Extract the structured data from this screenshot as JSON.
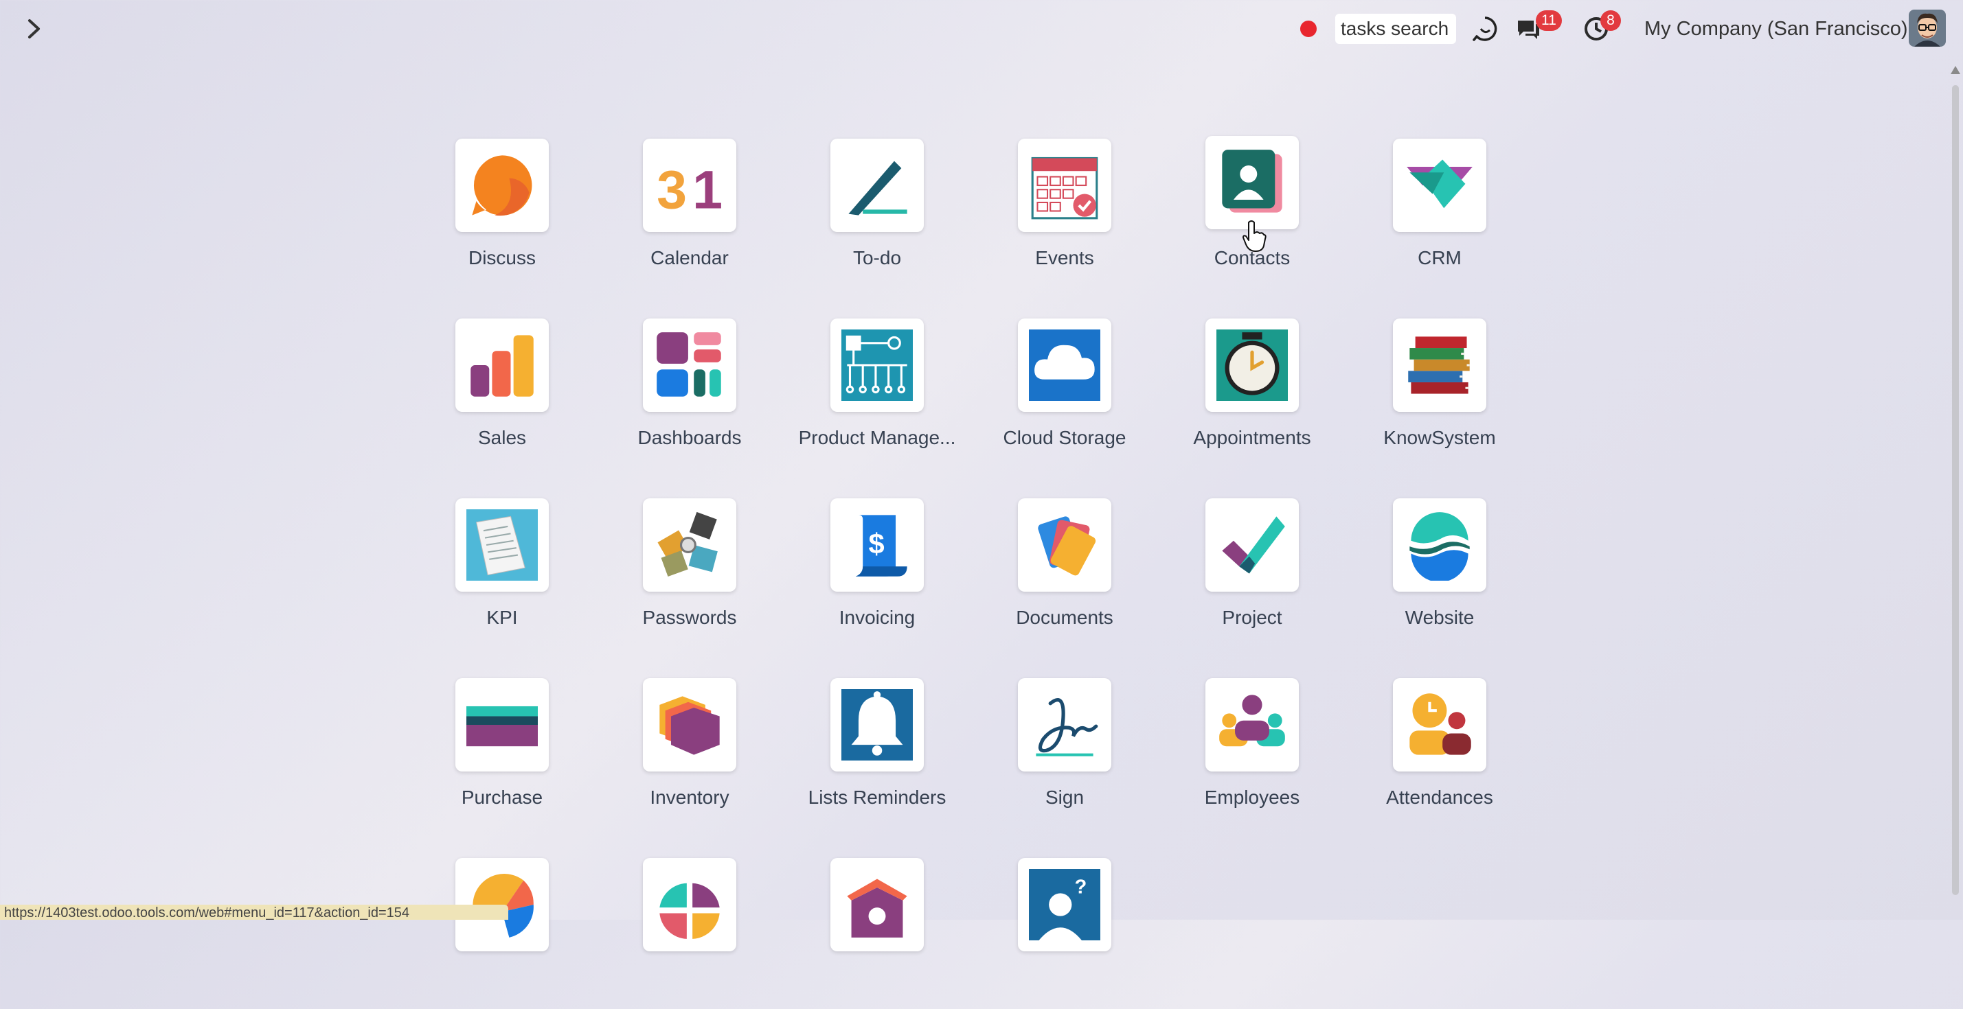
{
  "topbar": {
    "search_text": "tasks search",
    "messages_badge": "11",
    "activities_badge": "8",
    "company": "My Company (San Francisco)"
  },
  "apps": [
    {
      "label": "Discuss",
      "icon": "discuss-icon"
    },
    {
      "label": "Calendar",
      "icon": "calendar-icon"
    },
    {
      "label": "To-do",
      "icon": "todo-icon"
    },
    {
      "label": "Events",
      "icon": "events-icon"
    },
    {
      "label": "Contacts",
      "icon": "contacts-icon"
    },
    {
      "label": "CRM",
      "icon": "crm-icon"
    },
    {
      "label": "Sales",
      "icon": "sales-icon"
    },
    {
      "label": "Dashboards",
      "icon": "dashboards-icon"
    },
    {
      "label": "Product Manage...",
      "icon": "product-management-icon"
    },
    {
      "label": "Cloud Storage",
      "icon": "cloud-storage-icon"
    },
    {
      "label": "Appointments",
      "icon": "appointments-icon"
    },
    {
      "label": "KnowSystem",
      "icon": "knowsystem-icon"
    },
    {
      "label": "KPI",
      "icon": "kpi-icon"
    },
    {
      "label": "Passwords",
      "icon": "passwords-icon"
    },
    {
      "label": "Invoicing",
      "icon": "invoicing-icon"
    },
    {
      "label": "Documents",
      "icon": "documents-icon"
    },
    {
      "label": "Project",
      "icon": "project-icon"
    },
    {
      "label": "Website",
      "icon": "website-icon"
    },
    {
      "label": "Purchase",
      "icon": "purchase-icon"
    },
    {
      "label": "Inventory",
      "icon": "inventory-icon"
    },
    {
      "label": "Lists Reminders",
      "icon": "lists-reminders-icon"
    },
    {
      "label": "Sign",
      "icon": "sign-icon"
    },
    {
      "label": "Employees",
      "icon": "employees-icon"
    },
    {
      "label": "Attendances",
      "icon": "attendances-icon"
    },
    {
      "label": "",
      "icon": "app-icon-partial-1"
    },
    {
      "label": "",
      "icon": "app-icon-partial-2"
    },
    {
      "label": "",
      "icon": "app-icon-partial-3"
    },
    {
      "label": "",
      "icon": "app-icon-partial-4"
    }
  ],
  "statusbar": {
    "url": "https://1403test.odoo.tools.com/web#menu_id=117&action_id=154"
  }
}
